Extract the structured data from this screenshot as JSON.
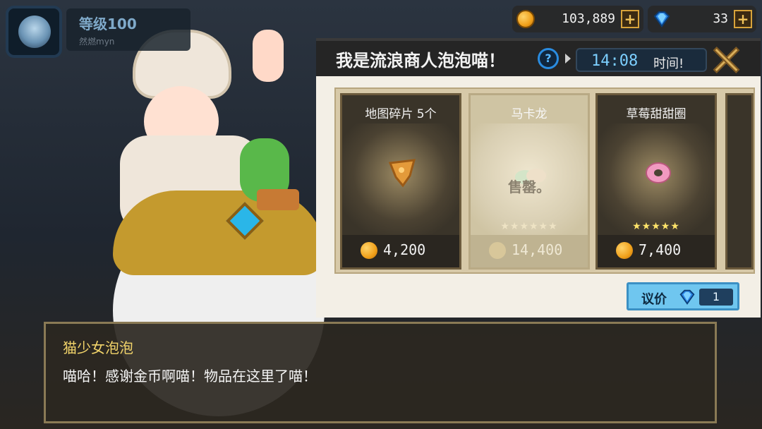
{
  "player": {
    "level": "等级100",
    "name": "然燃myn"
  },
  "currency": {
    "gold": "103,889",
    "gems": "33",
    "plus": "+"
  },
  "merchant": {
    "title": "我是流浪商人泡泡喵！",
    "help": "?",
    "timer": "14:08",
    "timer_label": "时间!",
    "items": [
      {
        "name": "地图碎片 5个",
        "price": "4,200",
        "stars": "",
        "sold_out": false
      },
      {
        "name": "马卡龙",
        "price": "14,400",
        "stars": "★★★★★★",
        "sold_out": true,
        "sold_label": "售罄。"
      },
      {
        "name": "草莓甜甜圈",
        "price": "7,400",
        "stars": "★★★★★",
        "sold_out": false
      }
    ],
    "bargain_label": "议价",
    "bargain_count": "1"
  },
  "dialog": {
    "speaker": "猫少女泡泡",
    "line": "喵哈！感谢金币啊喵！物品在这里了喵！"
  },
  "colors": {
    "accent": "#f2d46a",
    "timer": "#7ccfff",
    "bargain": "#6fc6ef"
  }
}
